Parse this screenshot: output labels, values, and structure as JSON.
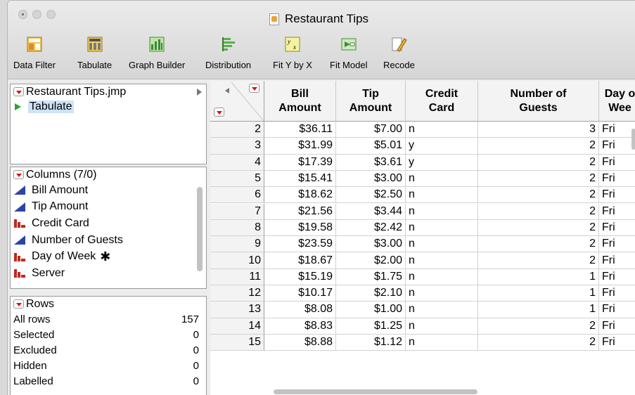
{
  "window": {
    "title": "Restaurant Tips"
  },
  "toolbar": [
    {
      "label": "Data Filter",
      "icon": "data-filter-icon"
    },
    {
      "label": "Tabulate",
      "icon": "tabulate-icon"
    },
    {
      "label": "Graph Builder",
      "icon": "graph-builder-icon"
    },
    {
      "label": "Distribution",
      "icon": "distribution-icon"
    },
    {
      "label": "Fit Y by X",
      "icon": "fit-y-by-x-icon"
    },
    {
      "label": "Fit Model",
      "icon": "fit-model-icon"
    },
    {
      "label": "Recode",
      "icon": "recode-icon"
    }
  ],
  "table_panel": {
    "file_name": "Restaurant Tips.jmp",
    "scripts": [
      "Tabulate"
    ]
  },
  "columns_panel": {
    "header": "Columns (7/0)",
    "items": [
      {
        "name": "Bill Amount",
        "type": "continuous"
      },
      {
        "name": "Tip Amount",
        "type": "continuous"
      },
      {
        "name": "Credit Card",
        "type": "nominal"
      },
      {
        "name": "Number of Guests",
        "type": "continuous"
      },
      {
        "name": "Day of Week",
        "type": "nominal",
        "flag": "✱"
      },
      {
        "name": "Server",
        "type": "nominal"
      }
    ]
  },
  "rows_panel": {
    "header": "Rows",
    "items": [
      {
        "label": "All rows",
        "value": "157"
      },
      {
        "label": "Selected",
        "value": "0"
      },
      {
        "label": "Excluded",
        "value": "0"
      },
      {
        "label": "Hidden",
        "value": "0"
      },
      {
        "label": "Labelled",
        "value": "0"
      }
    ]
  },
  "grid": {
    "headers": [
      [
        "Bill",
        "Amount"
      ],
      [
        "Tip",
        "Amount"
      ],
      [
        "Credit",
        "Card"
      ],
      [
        "Number of",
        "Guests"
      ],
      [
        "Day o",
        "Wee"
      ]
    ],
    "rows": [
      {
        "n": "2",
        "bill": "$36.11",
        "tip": "$7.00",
        "card": "n",
        "guests": "3",
        "day": "Fri"
      },
      {
        "n": "3",
        "bill": "$31.99",
        "tip": "$5.01",
        "card": "y",
        "guests": "2",
        "day": "Fri"
      },
      {
        "n": "4",
        "bill": "$17.39",
        "tip": "$3.61",
        "card": "y",
        "guests": "2",
        "day": "Fri"
      },
      {
        "n": "5",
        "bill": "$15.41",
        "tip": "$3.00",
        "card": "n",
        "guests": "2",
        "day": "Fri"
      },
      {
        "n": "6",
        "bill": "$18.62",
        "tip": "$2.50",
        "card": "n",
        "guests": "2",
        "day": "Fri"
      },
      {
        "n": "7",
        "bill": "$21.56",
        "tip": "$3.44",
        "card": "n",
        "guests": "2",
        "day": "Fri"
      },
      {
        "n": "8",
        "bill": "$19.58",
        "tip": "$2.42",
        "card": "n",
        "guests": "2",
        "day": "Fri"
      },
      {
        "n": "9",
        "bill": "$23.59",
        "tip": "$3.00",
        "card": "n",
        "guests": "2",
        "day": "Fri"
      },
      {
        "n": "10",
        "bill": "$18.67",
        "tip": "$2.00",
        "card": "n",
        "guests": "2",
        "day": "Fri"
      },
      {
        "n": "11",
        "bill": "$15.19",
        "tip": "$1.75",
        "card": "n",
        "guests": "1",
        "day": "Fri"
      },
      {
        "n": "12",
        "bill": "$10.17",
        "tip": "$2.10",
        "card": "n",
        "guests": "1",
        "day": "Fri"
      },
      {
        "n": "13",
        "bill": "$8.08",
        "tip": "$1.00",
        "card": "n",
        "guests": "1",
        "day": "Fri"
      },
      {
        "n": "14",
        "bill": "$8.83",
        "tip": "$1.25",
        "card": "n",
        "guests": "2",
        "day": "Fri"
      },
      {
        "n": "15",
        "bill": "$8.88",
        "tip": "$1.12",
        "card": "n",
        "guests": "2",
        "day": "Fri"
      }
    ]
  }
}
